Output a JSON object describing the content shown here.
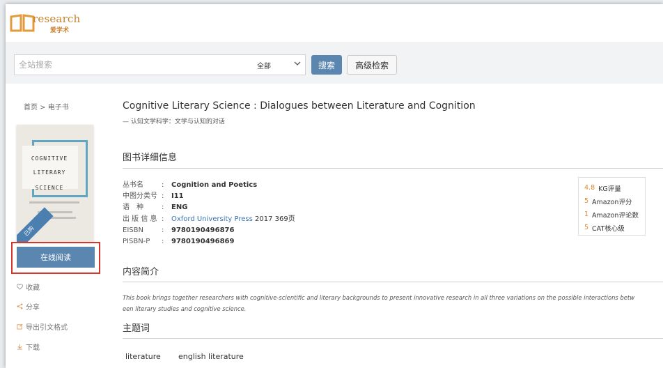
{
  "header": {
    "logo_text": "research",
    "logo_subtext": "爱学术"
  },
  "search": {
    "placeholder": "全站搜索",
    "scope": "全部",
    "search_button": "搜索",
    "advanced_button": "高级检索"
  },
  "breadcrumb": "首页 > 电子书",
  "cover": {
    "line1": "COGNITIVE",
    "line2": "LITERARY",
    "line3": "SCIENCE",
    "ribbon": "已购"
  },
  "sidebar": {
    "read_online": "在线阅读",
    "favorite": "收藏",
    "share": "分享",
    "export_citation": "导出引文格式",
    "download": "下载"
  },
  "book": {
    "title": "Cognitive Literary Science : Dialogues between Literature and Cognition",
    "subtitle": "— 认知文学科学：文学与认知的对话"
  },
  "sections": {
    "details": "图书详细信息",
    "intro": "内容简介",
    "keywords": "主题词"
  },
  "details": [
    {
      "label": "丛书名",
      "value": "Cognition and Poetics"
    },
    {
      "label": "中图分类号",
      "value": "I11"
    },
    {
      "label": "语　种",
      "value": "ENG"
    },
    {
      "label": "出 版 信 息",
      "publisher": "Oxford University Press",
      "rest": "2017 369页"
    },
    {
      "label": "EISBN",
      "value": "9780190496876"
    },
    {
      "label": "PISBN-P",
      "value": "9780190496869"
    }
  ],
  "metrics": [
    {
      "value": "4.8",
      "label": "KG评量"
    },
    {
      "value": "5",
      "label": "Amazon评分"
    },
    {
      "value": "1",
      "label": "Amazon评论数"
    },
    {
      "value": "5",
      "label": "CAT核心级"
    }
  ],
  "intro_text": {
    "line1": "This book brings together researchers with cognitive-scientific and literary backgrounds to present innovative research in all three variations on the possible interactions betw",
    "line2": "een literary studies and cognitive science."
  },
  "keywords": [
    "literature",
    "english literature"
  ],
  "colors": {
    "accent": "#5b86b0",
    "highlight_border": "#d9342b",
    "metric_value": "#e08a2b",
    "link": "#3a73b0"
  }
}
